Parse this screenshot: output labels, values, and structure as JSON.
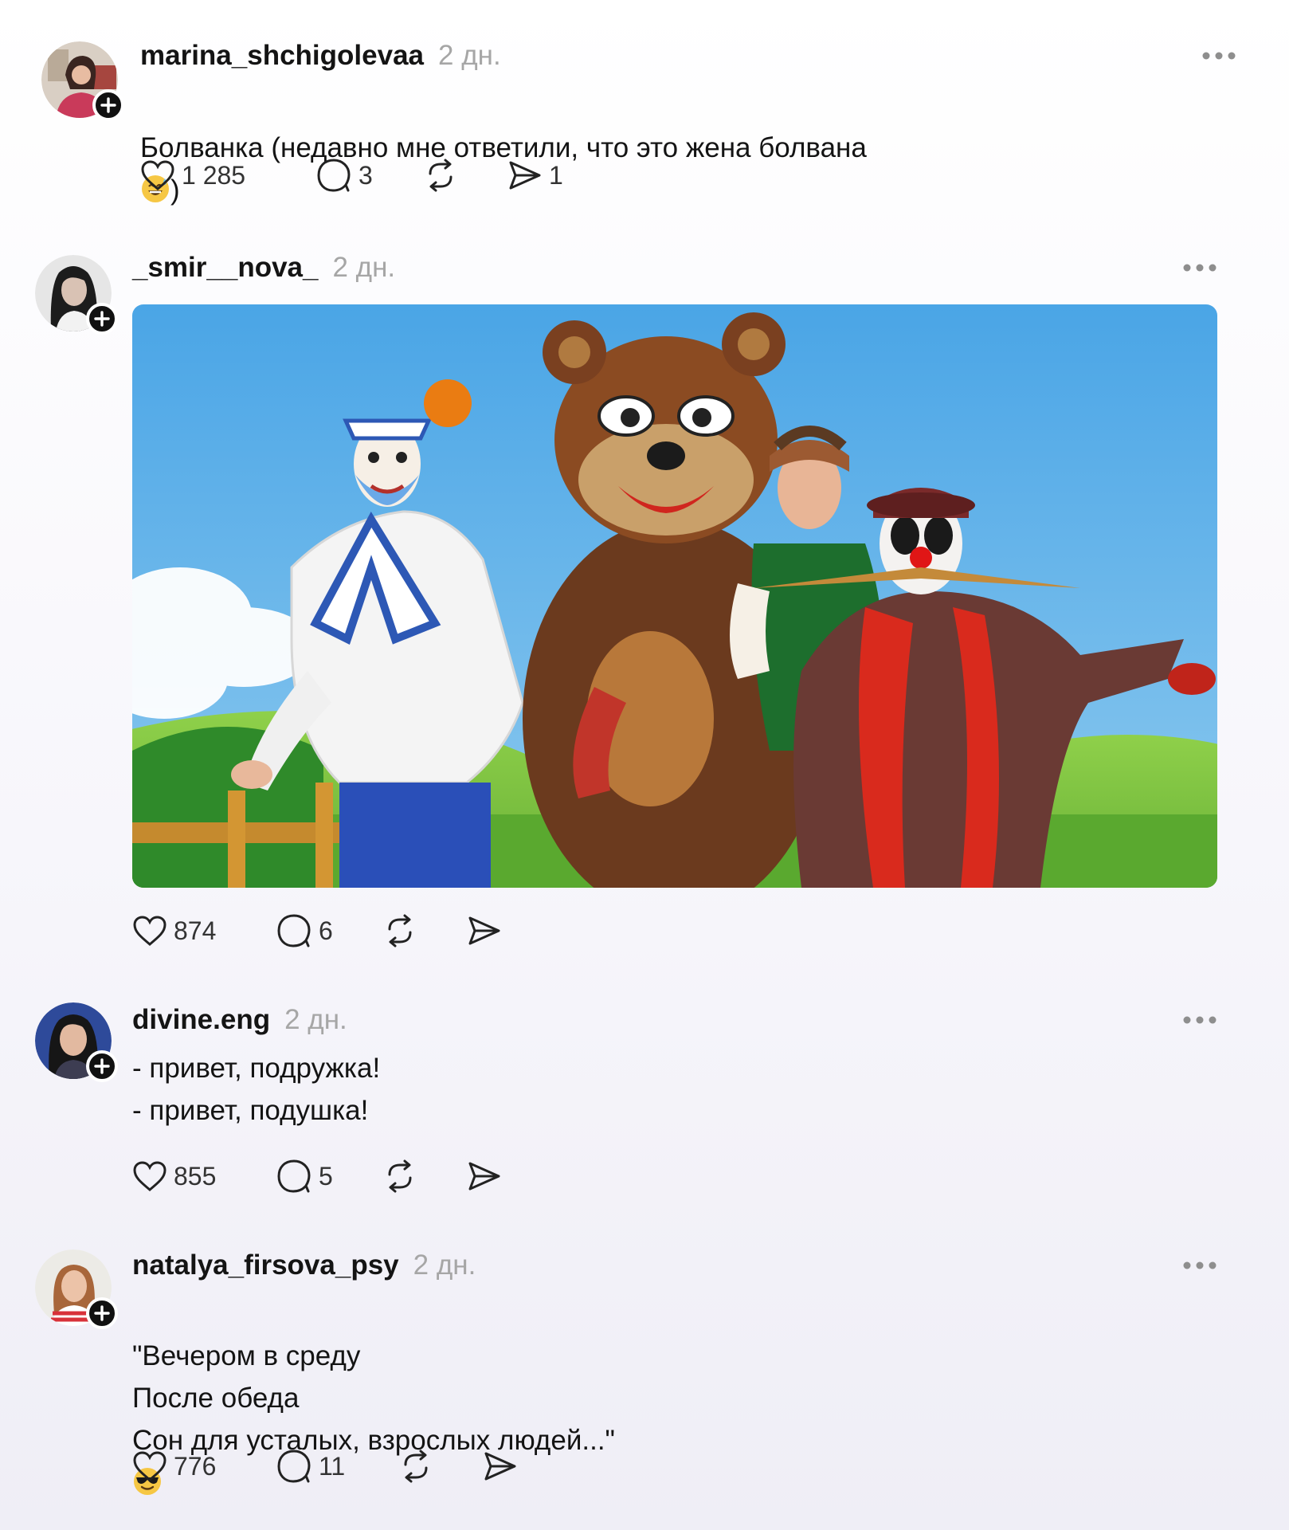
{
  "posts": [
    {
      "username": "marina_shchigolevaa",
      "time": "2 дн.",
      "text": "Болванка (недавно мне ответили, что это жена болвана",
      "text_suffix": ")",
      "emoji": "sweat-smile-emoji",
      "likes": "1 285",
      "comments": "3",
      "shares": "1"
    },
    {
      "username": "_smir__nova_",
      "time": "2 дн.",
      "image": "photo-clowns-and-bear-costume",
      "likes": "874",
      "comments": "6"
    },
    {
      "username": "divine.eng",
      "time": "2 дн.",
      "text": "- привет, подружка!\n- привет, подушка!",
      "likes": "855",
      "comments": "5"
    },
    {
      "username": "natalya_firsova_psy",
      "time": "2 дн.",
      "text": "\"Вечером в среду\nПосле обеда\nСон для усталых, взрослых людей...\"",
      "emoji": "sunglasses-emoji",
      "likes": "776",
      "comments": "11"
    }
  ],
  "icons": {
    "like": "heart-icon",
    "comment": "comment-bubble-icon",
    "repost": "repost-icon",
    "share": "send-icon",
    "more": "more-dots-icon",
    "follow": "plus-icon"
  },
  "colors": {
    "text": "#141414",
    "muted": "#a6a6a6",
    "icon": "#333333"
  }
}
